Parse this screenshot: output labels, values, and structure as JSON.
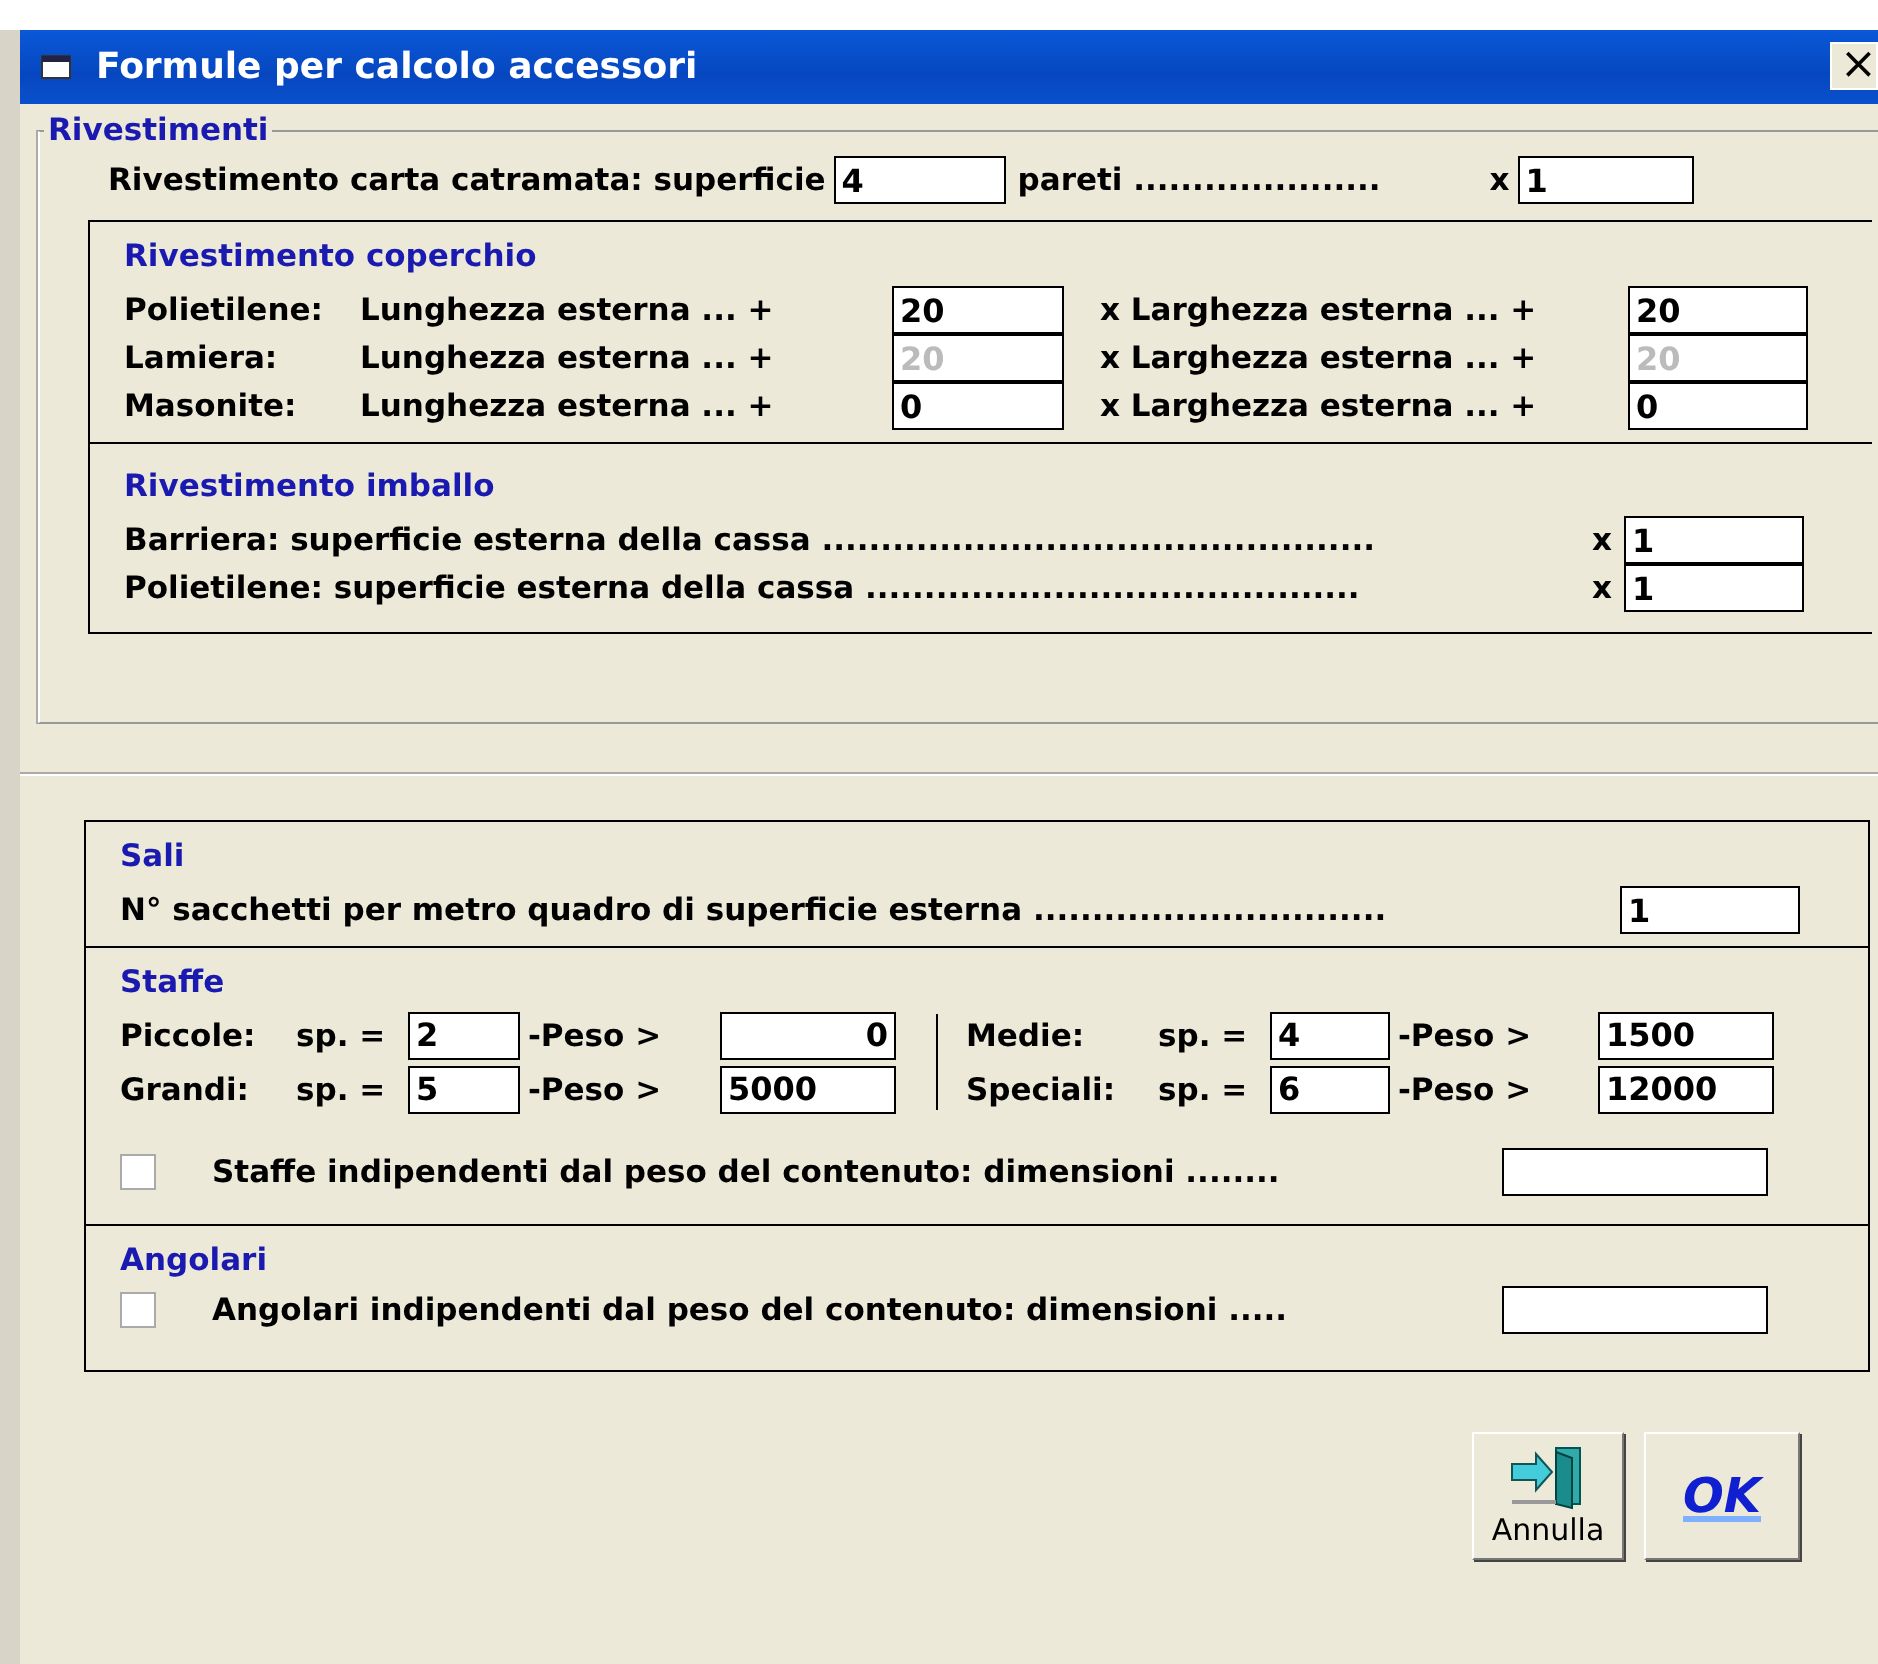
{
  "window": {
    "title": "Formule per calcolo accessori",
    "close": "×"
  },
  "rivestimenti": {
    "title": "Rivestimenti",
    "carta": {
      "label": "Rivestimento carta catramata: superficie",
      "field": {
        "value": "4"
      },
      "label2": "pareti .....................",
      "mult": "x",
      "field2": {
        "value": "1"
      }
    },
    "coperchio": {
      "title": "Rivestimento coperchio",
      "rows": [
        {
          "material": "Polietilene:",
          "length_label": "Lunghezza esterna ... +",
          "length": {
            "value": "20",
            "disabled": false
          },
          "width_label": "x Larghezza esterna ... +",
          "width": {
            "value": "20",
            "disabled": false
          }
        },
        {
          "material": "Lamiera:",
          "length_label": "Lunghezza esterna ... +",
          "length": {
            "value": "20",
            "disabled": true
          },
          "width_label": "x Larghezza esterna ... +",
          "width": {
            "value": "20",
            "disabled": true
          }
        },
        {
          "material": "Masonite:",
          "length_label": "Lunghezza esterna ... +",
          "length": {
            "value": "0",
            "disabled": false
          },
          "width_label": "x Larghezza esterna ... +",
          "width": {
            "value": "0",
            "disabled": false
          }
        }
      ]
    },
    "imballo": {
      "title": "Rivestimento imballo",
      "rows": [
        {
          "label": "Barriera: superficie esterna della cassa ...............................................",
          "mult": "x",
          "field": {
            "value": "1"
          }
        },
        {
          "label": "Polietilene: superficie esterna della cassa ..........................................",
          "mult": "x",
          "field": {
            "value": "1"
          }
        }
      ]
    }
  },
  "sali": {
    "title": "Sali",
    "label": "N° sacchetti per metro quadro di superficie esterna ..............................",
    "field": {
      "value": "1"
    }
  },
  "staffe": {
    "title": "Staffe",
    "columns": [
      [
        {
          "name": "Piccole:",
          "sp": "sp. =",
          "thickness": "2",
          "peso": "-Peso >",
          "weight": {
            "value": "0",
            "right_aligned": true
          }
        },
        {
          "name": "Grandi:",
          "sp": "sp. =",
          "thickness": "5",
          "peso": "-Peso >",
          "weight": {
            "value": "5000",
            "right_aligned": false
          }
        }
      ],
      [
        {
          "name": "Medie:",
          "sp": "sp. =",
          "thickness": "4",
          "peso": "-Peso >",
          "weight": {
            "value": "1500",
            "right_aligned": false
          }
        },
        {
          "name": "Speciali:",
          "sp": "sp. =",
          "thickness": "6",
          "peso": "-Peso >",
          "weight": {
            "value": "12000",
            "right_aligned": false
          }
        }
      ]
    ],
    "option": {
      "label": "Staffe indipendenti dal peso del contenuto: dimensioni ........",
      "checked": false
    }
  },
  "angolari": {
    "title": "Angolari",
    "option": {
      "label": "Angolari indipendenti dal peso del contenuto: dimensioni .....",
      "checked": false
    }
  },
  "buttons": {
    "cancel": "Annulla",
    "ok": "OK"
  }
}
